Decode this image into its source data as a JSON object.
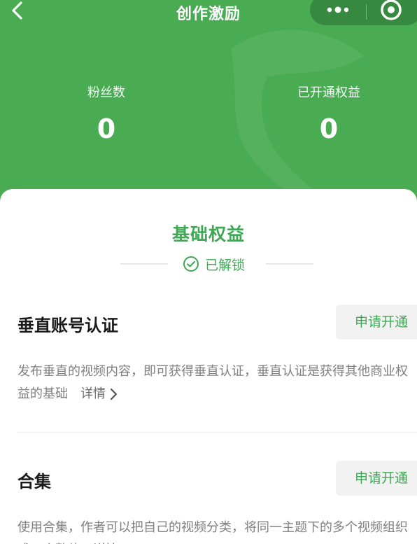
{
  "nav": {
    "title": "创作激励"
  },
  "stats": {
    "fans_label": "粉丝数",
    "fans_value": "0",
    "rights_label": "已开通权益",
    "rights_value": "0"
  },
  "section": {
    "title": "基础权益",
    "unlock_text": "已解锁"
  },
  "benefits": [
    {
      "title": "垂直账号认证",
      "button": "申请开通",
      "desc": "发布垂直的视频内容，即可获得垂直认证，垂直认证是获得其他商业权益的基础",
      "detail": "详情"
    },
    {
      "title": "合集",
      "button": "申请开通",
      "desc": "使用合集，作者可以把自己的视频分类，将同一主题下的多个视频组织成一个整体",
      "detail": "详情"
    }
  ],
  "colors": {
    "header_green": "#49ac52",
    "accent_green": "#3fa756"
  }
}
